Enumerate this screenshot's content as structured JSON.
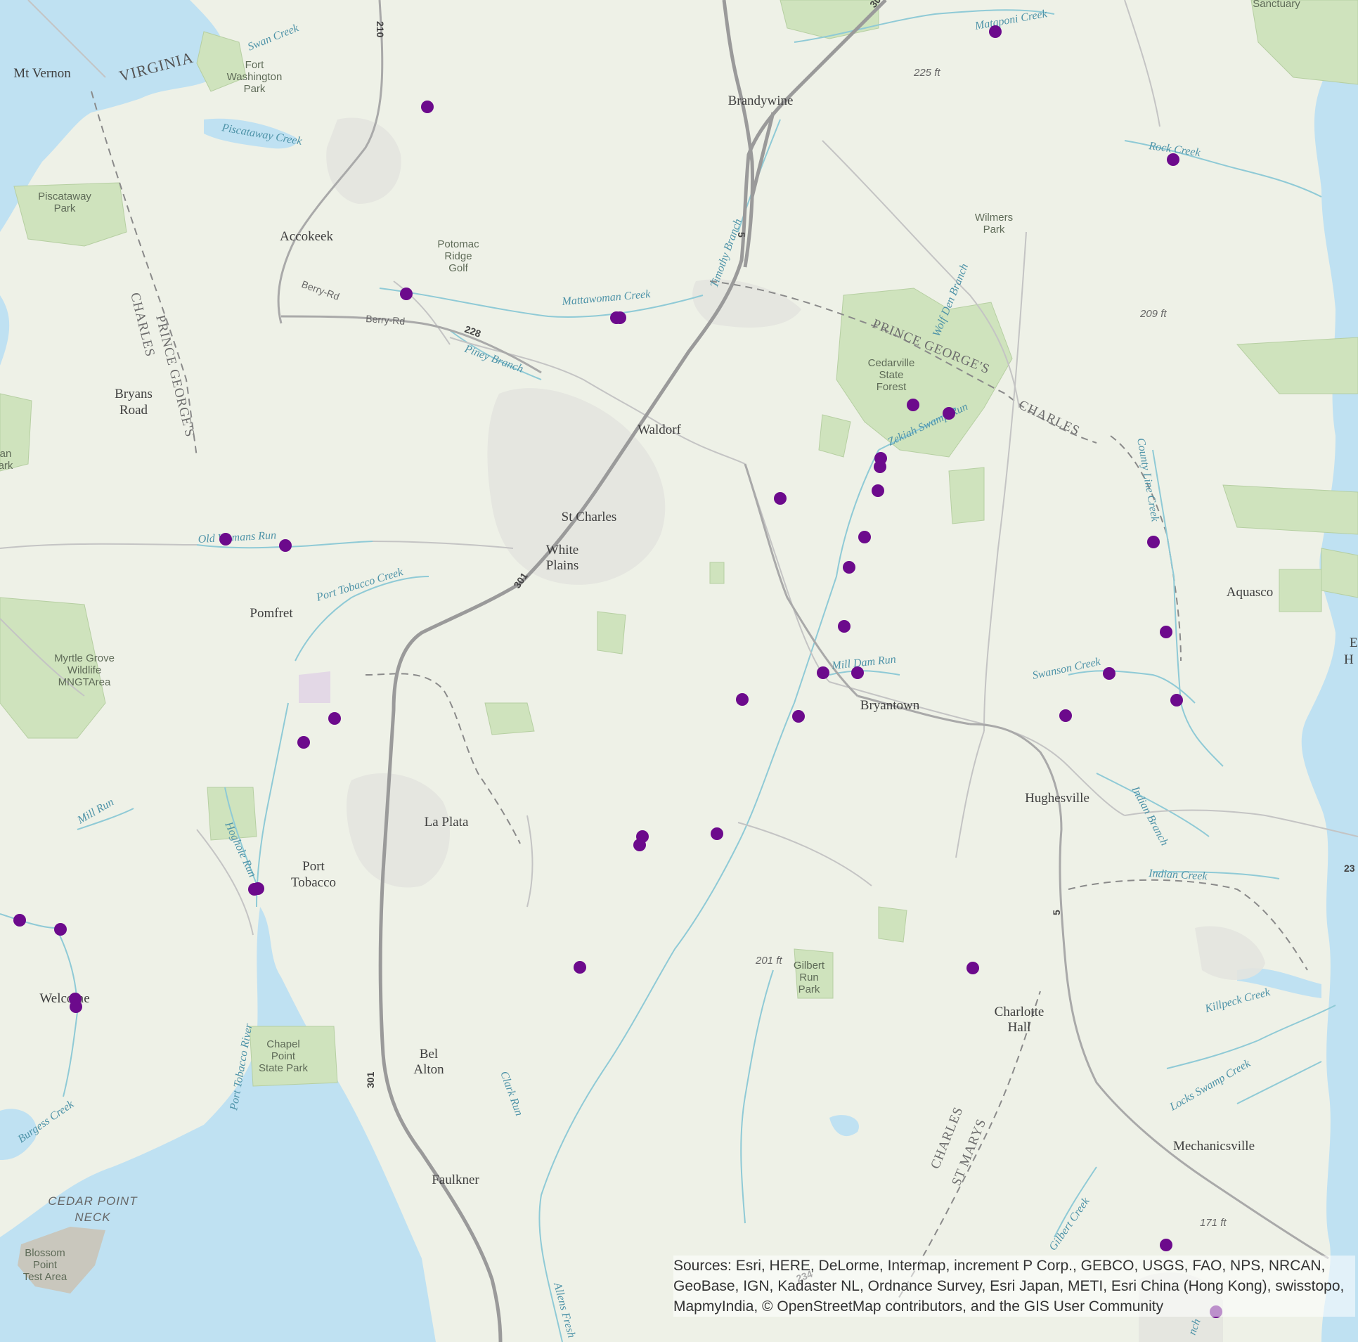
{
  "colors": {
    "land": "#eef1e7",
    "water": "#bfe1f2",
    "park": "#cfe3bd",
    "urban": "#e3e4df",
    "highway": "#9a9a9a",
    "road": "#b9b9b9",
    "stream": "#8fcad6",
    "boundary": "#8a8a8a",
    "marker": "#6c0a8c"
  },
  "state_labels": [
    {
      "name": "state-virginia",
      "text": "VIRGINIA"
    }
  ],
  "county_labels": [
    {
      "name": "county-charles-west",
      "text": "CHARLES"
    },
    {
      "name": "county-prince-georges-west",
      "text": "PRINCE GEORGE'S"
    },
    {
      "name": "county-prince-georges-east",
      "text": "PRINCE GEORGE'S"
    },
    {
      "name": "county-charles-east",
      "text": "CHARLES"
    },
    {
      "name": "county-charles-south",
      "text": "CHARLES"
    },
    {
      "name": "county-st-marys",
      "text": "ST MARYS"
    }
  ],
  "places": [
    {
      "name": "place-mt-vernon",
      "text": "Mt Vernon"
    },
    {
      "name": "place-brandywine",
      "text": "Brandywine"
    },
    {
      "name": "place-accokeek",
      "text": "Accokeek"
    },
    {
      "name": "place-bryans-road",
      "lines": [
        "Bryans",
        "Road"
      ]
    },
    {
      "name": "place-waldorf",
      "text": "Waldorf"
    },
    {
      "name": "place-st-charles",
      "text": "St Charles"
    },
    {
      "name": "place-white-plains",
      "lines": [
        "White",
        "Plains"
      ]
    },
    {
      "name": "place-pomfret",
      "text": "Pomfret"
    },
    {
      "name": "place-aquasco",
      "text": "Aquasco"
    },
    {
      "name": "place-bryantown",
      "text": "Bryantown"
    },
    {
      "name": "place-hughesville",
      "text": "Hughesville"
    },
    {
      "name": "place-la-plata",
      "text": "La Plata"
    },
    {
      "name": "place-port-tobacco",
      "lines": [
        "Port",
        "Tobacco"
      ]
    },
    {
      "name": "place-welcome",
      "text": "Welcome"
    },
    {
      "name": "place-charlotte-hall",
      "lines": [
        "Charlotte",
        "Hall"
      ]
    },
    {
      "name": "place-bel-alton",
      "lines": [
        "Bel",
        "Alton"
      ]
    },
    {
      "name": "place-faulkner",
      "text": "Faulkner"
    },
    {
      "name": "place-mechanicsville",
      "text": "Mechanicsville"
    }
  ],
  "parks": [
    {
      "name": "park-fort-washington",
      "lines": [
        "Fort",
        "Washington",
        "Park"
      ]
    },
    {
      "name": "park-piscataway",
      "lines": [
        "Piscataway",
        "Park"
      ]
    },
    {
      "name": "park-potomac-ridge-golf",
      "lines": [
        "Potomac",
        "Ridge",
        "Golf"
      ]
    },
    {
      "name": "park-wilmers",
      "lines": [
        "Wilmers",
        "Park"
      ]
    },
    {
      "name": "park-cedarville",
      "lines": [
        "Cedarville",
        "State",
        "Forest"
      ]
    },
    {
      "name": "park-myrtle-grove",
      "lines": [
        "Myrtle Grove",
        "Wildlife",
        "MNGTArea"
      ]
    },
    {
      "name": "park-chapel-point",
      "lines": [
        "Chapel",
        "Point",
        "State Park"
      ]
    },
    {
      "name": "park-gilbert-run",
      "lines": [
        "Gilbert",
        "Run",
        "Park"
      ]
    },
    {
      "name": "park-blossom-point",
      "lines": [
        "Blossom",
        "Point",
        "Test Area"
      ]
    },
    {
      "name": "park-sanctuary",
      "text": "Sanctuary"
    },
    {
      "name": "park-left-edge",
      "lines": [
        "an",
        "ark"
      ]
    }
  ],
  "regions": [
    {
      "name": "region-cedar-point-neck",
      "lines": [
        "CEDAR POINT",
        "NECK"
      ]
    }
  ],
  "waterways": [
    {
      "name": "water-swan-creek",
      "text": "Swan Creek"
    },
    {
      "name": "water-piscataway-creek",
      "text": "Piscataway Creek"
    },
    {
      "name": "water-mattaponi-creek",
      "text": "Mataponi Creek"
    },
    {
      "name": "water-rock-creek",
      "text": "Rock Creek"
    },
    {
      "name": "water-timothy-branch",
      "text": "Timothy Branch"
    },
    {
      "name": "water-mattawoman-creek",
      "text": "Mattawoman Creek"
    },
    {
      "name": "water-piney-branch",
      "text": "Piney Branch"
    },
    {
      "name": "water-wolf-den-branch",
      "text": "Wolf Den Branch"
    },
    {
      "name": "water-zekiah-swamp-run",
      "text": "Zekiah Swamp Run"
    },
    {
      "name": "water-county-line-creek",
      "text": "County Line Creek"
    },
    {
      "name": "water-old-womans-run",
      "text": "Old Womans Run"
    },
    {
      "name": "water-port-tobacco-creek",
      "text": "Port Tobacco Creek"
    },
    {
      "name": "water-mill-dam-run",
      "text": "Mill Dam Run"
    },
    {
      "name": "water-swanson-creek",
      "text": "Swanson Creek"
    },
    {
      "name": "water-indian-branch",
      "text": "Indian Branch"
    },
    {
      "name": "water-indian-creek",
      "text": "Indian Creek"
    },
    {
      "name": "water-mill-run",
      "text": "Mill Run"
    },
    {
      "name": "water-hoghole-run",
      "text": "Hoghole Run"
    },
    {
      "name": "water-killpeck-creek",
      "text": "Killpeck Creek"
    },
    {
      "name": "water-locks-swamp-creek",
      "text": "Locks Swamp Creek"
    },
    {
      "name": "water-port-tobacco-river",
      "text": "Port Tobacco River"
    },
    {
      "name": "water-burgess-creek",
      "text": "Burgess Creek"
    },
    {
      "name": "water-clark-run",
      "text": "Clark Run"
    },
    {
      "name": "water-allens-fresh",
      "text": "Allens Fresh"
    },
    {
      "name": "water-gilbert-creek",
      "text": "Gilbert Creek"
    },
    {
      "name": "water-branch-se",
      "text": "nch"
    }
  ],
  "elevations": [
    {
      "name": "elev-225",
      "text": "225 ft"
    },
    {
      "name": "elev-209",
      "text": "209 ft"
    },
    {
      "name": "elev-201",
      "text": "201 ft"
    },
    {
      "name": "elev-171",
      "text": "171 ft"
    }
  ],
  "routes": [
    {
      "name": "route-301-north",
      "text": "301"
    },
    {
      "name": "route-210",
      "text": "210"
    },
    {
      "name": "route-5-north",
      "text": "5"
    },
    {
      "name": "route-228",
      "text": "228"
    },
    {
      "name": "route-301-mid",
      "text": "301"
    },
    {
      "name": "route-301-south",
      "text": "301"
    },
    {
      "name": "route-5-south",
      "text": "5"
    },
    {
      "name": "route-23-edge",
      "text": "23"
    },
    {
      "name": "route-234",
      "text": "234"
    }
  ],
  "roads": [
    {
      "name": "road-berry-rd-1",
      "text": "Berry-Rd"
    },
    {
      "name": "road-berry-rd-2",
      "text": "Berry-Rd"
    }
  ],
  "edge_labels": [
    {
      "name": "edge-label-e",
      "text": "E"
    },
    {
      "name": "edge-label-h",
      "text": "H"
    }
  ],
  "marker_count": 47,
  "attribution": "Sources: Esri, HERE, DeLorme, Intermap, increment P Corp., GEBCO, USGS, FAO, NPS, NRCAN, GeoBase, IGN, Kadaster NL, Ordnance Survey, Esri Japan, METI, Esri China (Hong Kong), swisstopo, MapmyIndia, © OpenStreetMap contributors, and the GIS User Community"
}
